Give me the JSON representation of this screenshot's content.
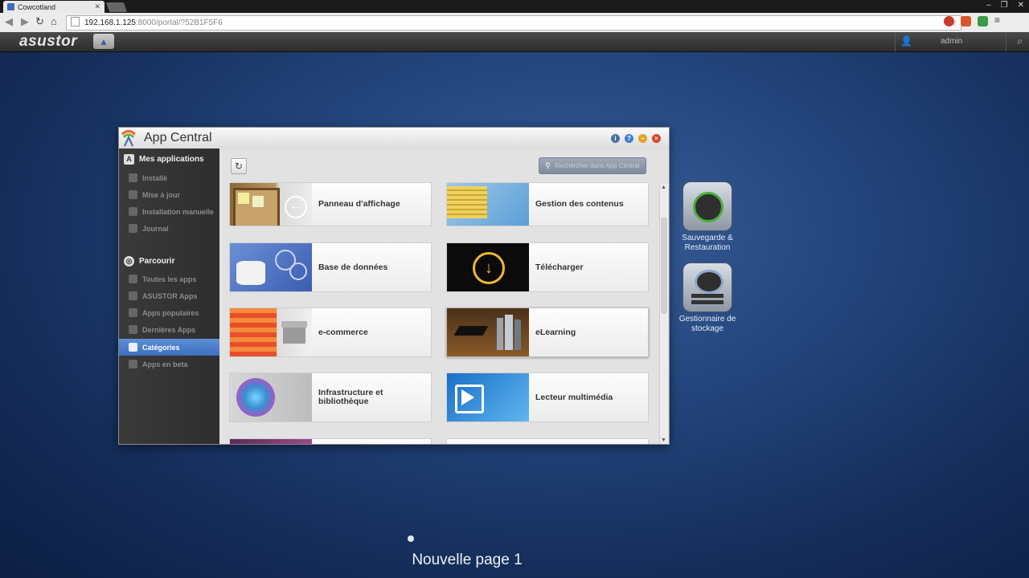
{
  "browser": {
    "tab_title": "Cowcotland",
    "url_host": "192.168.1.125",
    "url_rest": ":8000/portal/?52B1F5F6"
  },
  "topbar": {
    "logo": "asustor",
    "username": "admin"
  },
  "window": {
    "title": "App Central",
    "search_placeholder": "Rechercher dans App Central"
  },
  "sidebar": {
    "section1": "Mes applications",
    "items1": [
      "Installé",
      "Mise à jour",
      "Installation manuelle",
      "Journal"
    ],
    "section2": "Parcourir",
    "items2": [
      "Toutes les apps",
      "ASUSTOR Apps",
      "Apps populaires",
      "Dernières Apps",
      "Catégories",
      "Apps en beta"
    ]
  },
  "categories": [
    {
      "label": "Panneau d'affichage"
    },
    {
      "label": "Gestion des contenus"
    },
    {
      "label": "Base de données"
    },
    {
      "label": "Télécharger"
    },
    {
      "label": "e-commerce"
    },
    {
      "label": "eLearning"
    },
    {
      "label": "Infrastructure et bibliothèque"
    },
    {
      "label": "Lecteur multimédia"
    }
  ],
  "desktop": {
    "icon1": "Sauvegarde & Restauration",
    "icon2": "Gestionnaire de stockage",
    "page_label": "Nouvelle page 1"
  },
  "colors": {
    "accent": "#4a80d0",
    "sidebar": "#333333"
  }
}
